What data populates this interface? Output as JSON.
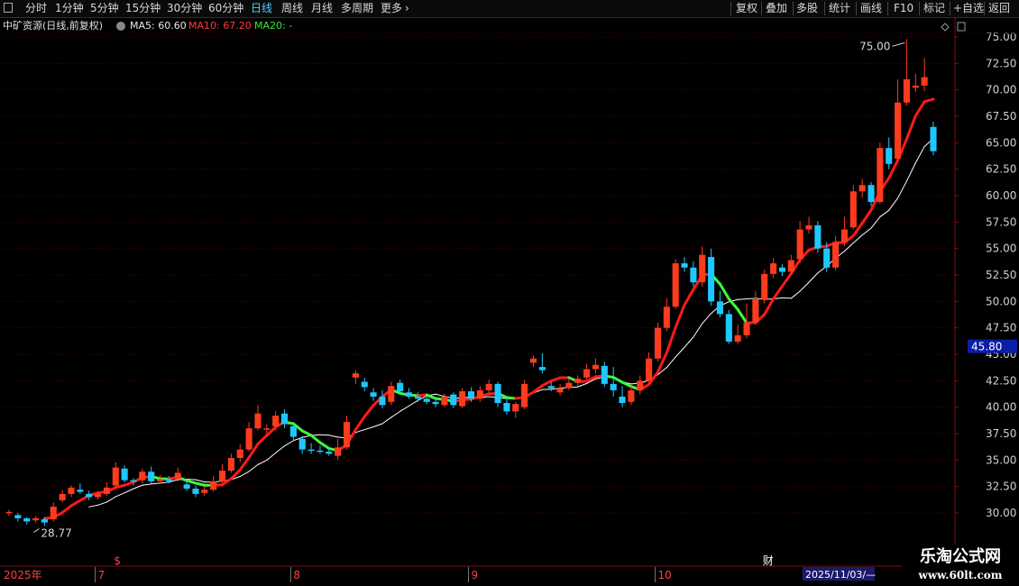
{
  "toolbar": {
    "left": [
      {
        "label": "分时",
        "active": false
      },
      {
        "label": "1分钟",
        "active": false
      },
      {
        "label": "5分钟",
        "active": false
      },
      {
        "label": "15分钟",
        "active": false
      },
      {
        "label": "30分钟",
        "active": false
      },
      {
        "label": "60分钟",
        "active": false
      },
      {
        "label": "日线",
        "active": true
      },
      {
        "label": "周线",
        "active": false
      },
      {
        "label": "月线",
        "active": false
      },
      {
        "label": "多周期",
        "active": false
      },
      {
        "label": "更多",
        "active": false
      }
    ],
    "more_arrow": "›",
    "right": [
      {
        "label": "复权"
      },
      {
        "label": "叠加"
      },
      {
        "label": "多股"
      },
      {
        "label": "统计"
      },
      {
        "label": "画线"
      },
      {
        "label": "F10"
      },
      {
        "label": "标记"
      },
      {
        "label": "+自选"
      },
      {
        "label": "返回"
      }
    ]
  },
  "info": {
    "title": "中矿资源(日线,前复权)",
    "ma5": "MA5: 60.60",
    "ma10": "MA10: 67.20",
    "ma20": "MA20: -"
  },
  "colors": {
    "up": "#ff3b1e",
    "down": "#1ec8ff",
    "ma_red": "#ff1a1a",
    "ma_green": "#3cff3c",
    "ma_white": "#ffffff",
    "grid": "#5a0000",
    "axis_line": "#7a1010",
    "price_tag_bg": "#0a1ea8"
  },
  "chart_data": {
    "type": "candlestick",
    "y_ticks": [
      "75.00",
      "72.50",
      "70.00",
      "67.50",
      "65.00",
      "62.50",
      "60.00",
      "57.50",
      "55.00",
      "52.50",
      "50.00",
      "47.50",
      "45.00",
      "42.50",
      "40.00",
      "37.50",
      "35.00",
      "32.50",
      "30.00"
    ],
    "ylim": [
      28,
      76.5
    ],
    "max_annotation": "75.00",
    "min_annotation": "28.77",
    "current_price_tag": "45.80",
    "date_labels": [
      {
        "label": "2025年",
        "index": 0
      },
      {
        "label": "7",
        "index": 10
      },
      {
        "label": "8",
        "index": 32
      },
      {
        "label": "9",
        "index": 52
      },
      {
        "label": "10",
        "index": 73
      },
      {
        "label": "2025/11/03/—",
        "index": 89
      }
    ],
    "markers": [
      {
        "label": "$",
        "index": 12,
        "color": "#ff3b3b"
      },
      {
        "label": "财",
        "index": 85,
        "color": "#ffffff"
      }
    ],
    "candles": [
      [
        30.0,
        30.1,
        30.3,
        29.7
      ],
      [
        29.8,
        29.5,
        30.0,
        29.2
      ],
      [
        29.5,
        29.2,
        29.6,
        28.9
      ],
      [
        29.3,
        29.5,
        29.7,
        29.1
      ],
      [
        29.4,
        29.1,
        29.6,
        28.77
      ],
      [
        29.4,
        30.6,
        31.0,
        29.2
      ],
      [
        31.2,
        31.8,
        32.2,
        31.0
      ],
      [
        31.8,
        32.4,
        32.6,
        31.5
      ],
      [
        32.2,
        32.0,
        32.8,
        31.8
      ],
      [
        31.8,
        31.5,
        32.1,
        31.2
      ],
      [
        31.5,
        31.8,
        32.0,
        31.3
      ],
      [
        31.8,
        32.4,
        32.9,
        31.6
      ],
      [
        32.6,
        34.3,
        34.8,
        32.4
      ],
      [
        34.2,
        33.1,
        34.5,
        32.9
      ],
      [
        33.1,
        33.0,
        33.3,
        32.6
      ],
      [
        33.1,
        33.9,
        34.2,
        32.8
      ],
      [
        33.9,
        33.0,
        34.4,
        32.8
      ],
      [
        33.0,
        33.2,
        33.6,
        32.8
      ],
      [
        33.2,
        33.0,
        33.5,
        32.8
      ],
      [
        33.2,
        33.8,
        34.3,
        33.0
      ],
      [
        32.7,
        32.3,
        33.2,
        32.1
      ],
      [
        32.3,
        31.8,
        32.6,
        31.5
      ],
      [
        31.9,
        32.2,
        32.5,
        31.6
      ],
      [
        32.2,
        33.0,
        33.5,
        32.0
      ],
      [
        33.0,
        34.0,
        34.6,
        32.8
      ],
      [
        34.0,
        35.2,
        35.6,
        33.8
      ],
      [
        35.2,
        36.0,
        36.5,
        34.8
      ],
      [
        36.0,
        38.0,
        38.6,
        35.8
      ],
      [
        38.0,
        39.4,
        40.2,
        37.8
      ],
      [
        38.0,
        38.0,
        38.4,
        37.4
      ],
      [
        38.2,
        39.2,
        39.6,
        37.8
      ],
      [
        39.4,
        38.4,
        39.8,
        38.0
      ],
      [
        38.2,
        37.2,
        38.6,
        36.8
      ],
      [
        37.0,
        36.0,
        37.3,
        35.6
      ],
      [
        36.0,
        35.9,
        36.6,
        35.6
      ],
      [
        35.9,
        35.8,
        36.4,
        35.6
      ],
      [
        35.8,
        35.6,
        36.2,
        35.4
      ],
      [
        35.4,
        36.2,
        37.0,
        35.0
      ],
      [
        36.2,
        38.6,
        39.2,
        36.0
      ],
      [
        42.8,
        43.2,
        43.5,
        42.2
      ],
      [
        42.4,
        41.9,
        42.8,
        41.5
      ],
      [
        41.4,
        41.0,
        41.8,
        40.6
      ],
      [
        41.0,
        40.2,
        41.6,
        39.9
      ],
      [
        40.5,
        42.0,
        42.4,
        40.2
      ],
      [
        42.3,
        41.5,
        42.6,
        41.2
      ],
      [
        41.4,
        41.0,
        41.8,
        40.8
      ],
      [
        41.0,
        40.8,
        41.4,
        40.5
      ],
      [
        40.8,
        40.5,
        41.0,
        40.3
      ],
      [
        40.5,
        40.3,
        40.8,
        40.0
      ],
      [
        40.2,
        41.0,
        41.3,
        40.0
      ],
      [
        41.2,
        40.2,
        41.4,
        39.9
      ],
      [
        40.1,
        41.5,
        41.8,
        39.9
      ],
      [
        41.5,
        40.8,
        41.9,
        40.5
      ],
      [
        40.8,
        41.6,
        42.0,
        40.5
      ],
      [
        41.6,
        42.2,
        42.6,
        41.3
      ],
      [
        42.2,
        40.4,
        42.4,
        40.0
      ],
      [
        40.4,
        39.6,
        40.9,
        39.3
      ],
      [
        39.6,
        40.3,
        40.5,
        39.0
      ],
      [
        40.0,
        42.2,
        42.6,
        39.8
      ],
      [
        44.2,
        44.6,
        44.9,
        43.8
      ],
      [
        43.8,
        43.5,
        45.1,
        43.2
      ],
      [
        42.0,
        41.8,
        42.4,
        41.5
      ],
      [
        41.4,
        41.8,
        42.2,
        41.1
      ],
      [
        41.8,
        42.3,
        42.7,
        41.6
      ],
      [
        42.3,
        42.7,
        43.0,
        42.0
      ],
      [
        42.8,
        43.6,
        44.1,
        42.6
      ],
      [
        43.6,
        44.0,
        44.6,
        43.2
      ],
      [
        43.9,
        42.2,
        44.3,
        41.9
      ],
      [
        42.2,
        41.6,
        43.8,
        41.0
      ],
      [
        41.0,
        40.4,
        42.0,
        40.0
      ],
      [
        40.5,
        41.6,
        42.0,
        40.2
      ],
      [
        41.6,
        42.5,
        43.0,
        41.2
      ],
      [
        42.5,
        44.6,
        45.2,
        42.2
      ],
      [
        44.6,
        47.5,
        48.0,
        44.3
      ],
      [
        47.5,
        49.5,
        50.3,
        47.2
      ],
      [
        49.5,
        53.6,
        54.0,
        49.3
      ],
      [
        53.6,
        53.2,
        54.2,
        52.8
      ],
      [
        53.2,
        51.8,
        53.8,
        51.4
      ],
      [
        51.8,
        54.4,
        55.2,
        51.4
      ],
      [
        54.2,
        50.0,
        55.0,
        49.6
      ],
      [
        50.0,
        48.8,
        51.0,
        48.5
      ],
      [
        48.8,
        46.2,
        49.2,
        46.0
      ],
      [
        46.2,
        46.8,
        47.8,
        46.0
      ],
      [
        46.8,
        48.0,
        49.8,
        46.5
      ],
      [
        48.0,
        50.2,
        51.0,
        47.8
      ],
      [
        50.2,
        52.6,
        53.0,
        49.8
      ],
      [
        52.6,
        53.6,
        54.1,
        52.2
      ],
      [
        53.2,
        52.8,
        53.5,
        52.4
      ],
      [
        52.8,
        53.9,
        54.4,
        52.6
      ],
      [
        54.0,
        56.8,
        57.6,
        53.6
      ],
      [
        56.8,
        57.2,
        58.0,
        56.4
      ],
      [
        57.2,
        55.0,
        57.6,
        54.6
      ],
      [
        55.0,
        53.2,
        55.6,
        52.8
      ],
      [
        53.2,
        55.6,
        56.2,
        52.9
      ],
      [
        55.6,
        56.8,
        58.0,
        55.2
      ],
      [
        57.0,
        60.4,
        61.0,
        56.8
      ],
      [
        60.4,
        61.0,
        61.6,
        59.8
      ],
      [
        61.0,
        59.4,
        61.3,
        59.0
      ],
      [
        59.4,
        64.5,
        65.0,
        59.2
      ],
      [
        64.5,
        63.0,
        65.5,
        62.5
      ],
      [
        63.5,
        68.8,
        71.0,
        63.2
      ],
      [
        68.8,
        71.0,
        74.8,
        68.5
      ],
      [
        70.2,
        70.4,
        71.5,
        69.8
      ],
      [
        70.4,
        71.2,
        73.0,
        69.9
      ],
      [
        66.5,
        64.2,
        67.0,
        63.8
      ]
    ]
  }
}
